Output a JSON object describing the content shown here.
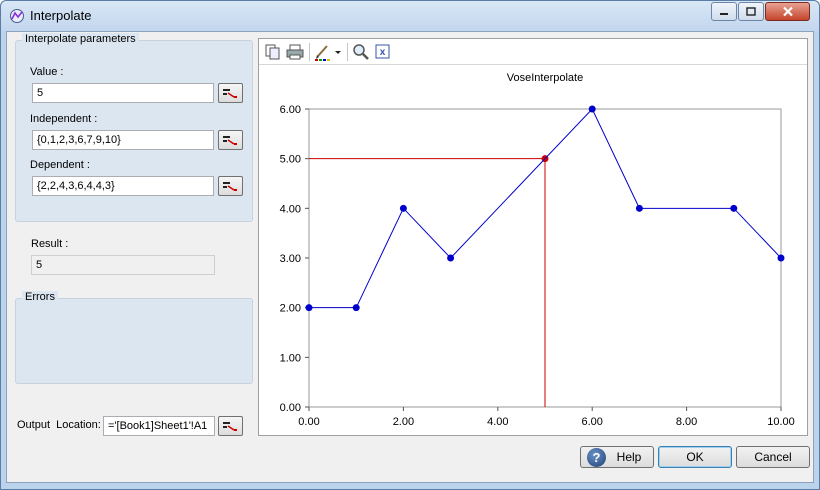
{
  "window": {
    "title": "Interpolate",
    "controls": [
      "minimize",
      "maximize",
      "close"
    ]
  },
  "params": {
    "group_title": "Interpolate parameters",
    "value_label": "Value :",
    "value": "5",
    "independent_label": "Independent :",
    "independent": "{0,1,2,3,6,7,9,10}",
    "dependent_label": "Dependent :",
    "dependent": "{2,2,4,3,6,4,4,3}"
  },
  "result": {
    "label": "Result :",
    "value": "5"
  },
  "errors": {
    "group_title": "Errors"
  },
  "output": {
    "label": "Output  Location:",
    "value": "='[Book1]Sheet1'!A1"
  },
  "toolbar": {
    "icons": [
      "copy-icon",
      "print-icon",
      "chart-style-icon",
      "dropdown-arrow-icon",
      "zoom-icon",
      "formula-icon"
    ]
  },
  "buttons": {
    "help": "Help",
    "ok": "OK",
    "cancel": "Cancel"
  },
  "chart_data": {
    "type": "line",
    "title": "VoseInterpolate",
    "xlabel": "",
    "ylabel": "",
    "xlim": [
      0,
      10
    ],
    "ylim": [
      0,
      6
    ],
    "x_ticks": [
      "0.00",
      "2.00",
      "4.00",
      "6.00",
      "8.00",
      "10.00"
    ],
    "y_ticks": [
      "0.00",
      "1.00",
      "2.00",
      "3.00",
      "4.00",
      "5.00",
      "6.00"
    ],
    "grid": false,
    "series": [
      {
        "color": "#0000cc",
        "x": [
          0,
          1,
          2,
          3,
          6,
          7,
          9,
          10
        ],
        "y": [
          2,
          2,
          4,
          3,
          6,
          4,
          4,
          3
        ]
      }
    ],
    "highlight": {
      "color": "#cc0000",
      "x": 5,
      "y": 5
    }
  }
}
